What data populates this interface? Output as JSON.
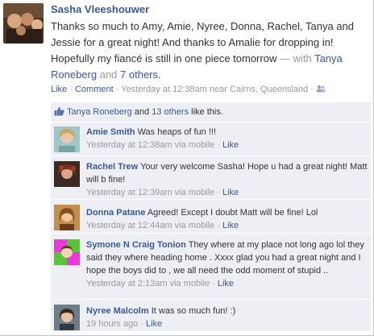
{
  "post": {
    "author": "Sasha Vleeshouwer",
    "text": "Thanks so much to Amy, Amie, Nyree, Donna, Rachel, Tanya and Jessie for a great night! And thanks to Amalie for dropping in! Hopefully my fiancé is still in one piece tomorrow",
    "with_prefix": " — with ",
    "tagged_name": "Tanya Roneberg",
    "and_word": " and ",
    "others_link": "7 others",
    "end_dot": ".",
    "like_label": "Like",
    "comment_label": "Comment",
    "timestamp": "Yesterday at 12:38am near Cairns, Queensland"
  },
  "likes": {
    "liker": "Tanya Roneberg",
    "and_word": " and ",
    "others_link": "13 others",
    "suffix": " like this."
  },
  "comments": [
    {
      "name": "Amie Smith",
      "text": "Was heaps of fun !!!",
      "time": "Yesterday at 12:38am via mobile",
      "like": "Like"
    },
    {
      "name": "Rachel Trew",
      "text": "Your very welcome Sasha! Hope u had a great night! Matt will b fine!",
      "time": "Yesterday at 12:39am via mobile",
      "like": "Like"
    },
    {
      "name": "Donna Patane",
      "text": "Agreed! Except I doubt Matt will be fine! Lol",
      "time": "Yesterday at 12:44am via mobile",
      "like": "Like"
    },
    {
      "name": "Symone N Craig Tonion",
      "text": "They where at my place not long ago lol they said they where heading home . Xxxx glad you had a great night and I hope the boys did to , we all need the odd moment of stupid ..",
      "time": "Yesterday at 2:13am via mobile",
      "like": "Like"
    },
    {
      "name": "Nyree Malcolm",
      "text": "It was so much fun! :)",
      "time": "19 hours ago",
      "like": "Like"
    }
  ],
  "colors": {
    "link": "#3b5998",
    "muted": "#999999",
    "box": "#edeff4"
  }
}
